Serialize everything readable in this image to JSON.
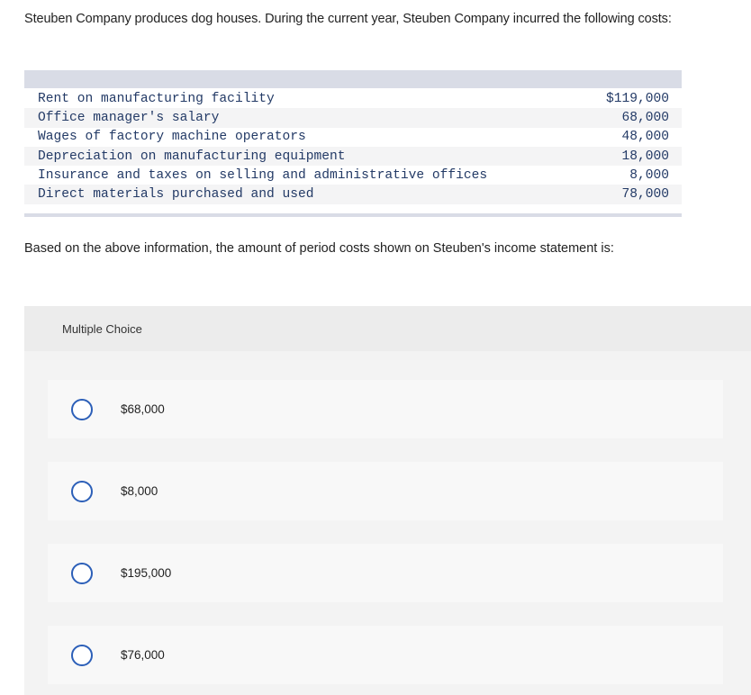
{
  "question": {
    "intro": "Steuben Company produces dog houses. During the current year, Steuben Company incurred the following costs:",
    "prompt": "Based on the above information, the amount of period costs shown on Steuben's income statement is:"
  },
  "cost_table": {
    "rows": [
      {
        "label": "Rent on manufacturing facility",
        "amount": "$119,000"
      },
      {
        "label": "Office manager's salary",
        "amount": "68,000"
      },
      {
        "label": "Wages of factory machine operators",
        "amount": "48,000"
      },
      {
        "label": "Depreciation on manufacturing equipment",
        "amount": "18,000"
      },
      {
        "label": "Insurance and taxes on selling and administrative offices",
        "amount": "8,000"
      },
      {
        "label": "Direct materials purchased and used",
        "amount": "78,000"
      }
    ]
  },
  "multiple_choice": {
    "header": "Multiple Choice",
    "choices": [
      {
        "label": "$68,000"
      },
      {
        "label": "$8,000"
      },
      {
        "label": "$195,000"
      },
      {
        "label": "$76,000"
      }
    ]
  },
  "colors": {
    "radio_border": "#2c5fb8",
    "table_text": "#233a66",
    "table_bar": "#d9dce6"
  }
}
